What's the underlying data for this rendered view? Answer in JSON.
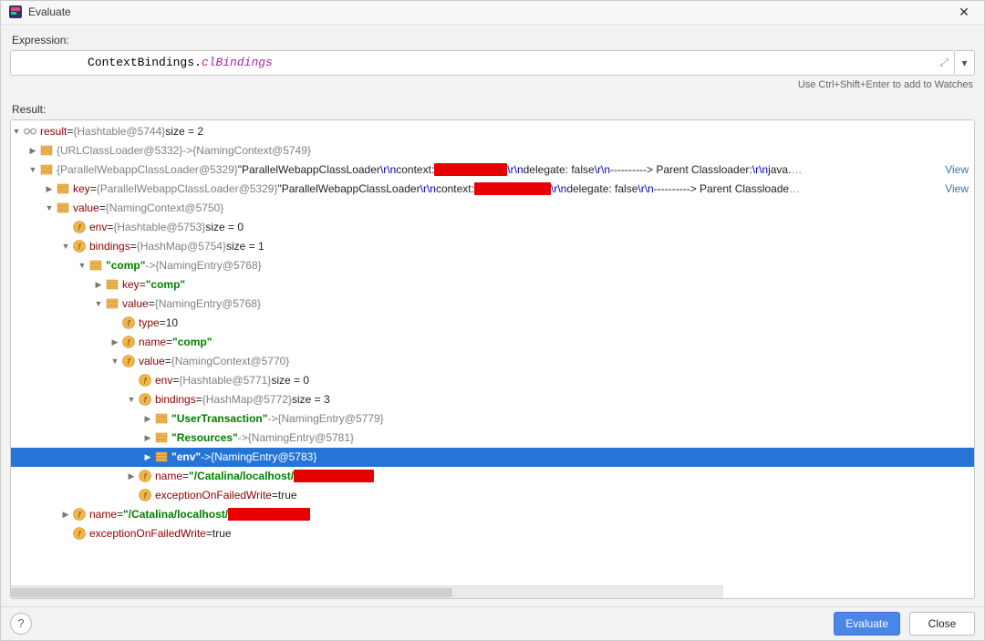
{
  "window": {
    "title": "Evaluate",
    "close_glyph": "✕"
  },
  "expression": {
    "label": "Expression:",
    "prefix": "ContextBindings.",
    "member": "clBindings",
    "expand_glyph": "⤢",
    "dropdown_glyph": "▾"
  },
  "hint": "Use Ctrl+Shift+Enter to add to Watches",
  "result_label": "Result:",
  "buttons": {
    "help_glyph": "?",
    "evaluate": "Evaluate",
    "close": "Close"
  },
  "glyphs": {
    "down": "▼",
    "right": "▶"
  },
  "rows": {
    "r0": {
      "name": "result",
      "eq": " = ",
      "val": "{Hashtable@5744}",
      "size": "  size = 2"
    },
    "r1": {
      "left": "{URLClassLoader@5332}",
      "arrow": " -> ",
      "right": "{NamingContext@5749}"
    },
    "r2": {
      "left": "{ParallelWebappClassLoader@5329}",
      "sp": " ",
      "q1": "\"ParallelWebappClassLoader",
      "rn1": "\\r\\n",
      "ctx": "  context:",
      "rn2": "\\r\\n",
      "del": "  delegate: false",
      "rn3": "\\r\\n",
      "dash": "----------> Parent Classloader:",
      "rn4": "\\r\\n",
      "tail": "java.",
      "ell": "…",
      "view": " View"
    },
    "r3": {
      "key": "key",
      "eq": " = ",
      "left": "{ParallelWebappClassLoader@5329}",
      "sp": " ",
      "q1": "\"ParallelWebappClassLoader",
      "rn1": "\\r\\n",
      "ctx": "  context:",
      "rn2": "\\r\\n",
      "del": "  delegate: false",
      "rn3": "\\r\\n",
      "dash": "----------> Parent Classloade",
      "ell": "…",
      "view": " View"
    },
    "r4": {
      "name": "value",
      "eq": " = ",
      "val": "{NamingContext@5750}"
    },
    "r5": {
      "name": "env",
      "eq": " = ",
      "val": "{Hashtable@5753}",
      "size": "  size = 0"
    },
    "r6": {
      "name": "bindings",
      "eq": " = ",
      "val": "{HashMap@5754}",
      "size": "  size = 1"
    },
    "r7": {
      "key": "\"comp\"",
      "arrow": " -> ",
      "val": "{NamingEntry@5768}"
    },
    "r8": {
      "name": "key",
      "eq": " = ",
      "val": "\"comp\""
    },
    "r9": {
      "name": "value",
      "eq": " = ",
      "val": "{NamingEntry@5768}"
    },
    "r10": {
      "name": "type",
      "eq": " = ",
      "val": "10"
    },
    "r11": {
      "name": "name",
      "eq": " = ",
      "val": "\"comp\""
    },
    "r12": {
      "name": "value",
      "eq": " = ",
      "val": "{NamingContext@5770}"
    },
    "r13": {
      "name": "env",
      "eq": " = ",
      "val": "{Hashtable@5771}",
      "size": "  size = 0"
    },
    "r14": {
      "name": "bindings",
      "eq": " = ",
      "val": "{HashMap@5772}",
      "size": "  size = 3"
    },
    "r15": {
      "key": "\"UserTransaction\"",
      "arrow": " -> ",
      "val": "{NamingEntry@5779}"
    },
    "r16": {
      "key": "\"Resources\"",
      "arrow": " -> ",
      "val": "{NamingEntry@5781}"
    },
    "r17": {
      "key": "\"env\"",
      "arrow": " -> ",
      "val": "{NamingEntry@5783}"
    },
    "r18": {
      "name": "name",
      "eq": " = ",
      "val": "\"/Catalina/localhost/"
    },
    "r19": {
      "name": "exceptionOnFailedWrite",
      "eq": " = ",
      "val": "true"
    },
    "r20": {
      "name": "name",
      "eq": " = ",
      "val": "\"/Catalina/localhost/"
    },
    "r21": {
      "name": "exceptionOnFailedWrite",
      "eq": " = ",
      "val": "true"
    }
  }
}
